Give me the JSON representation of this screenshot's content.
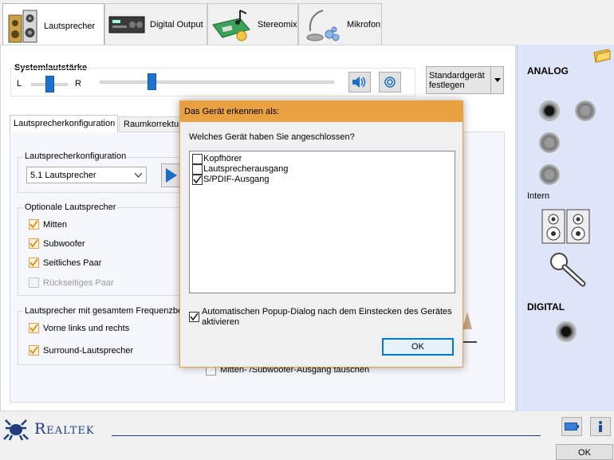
{
  "tabs": [
    {
      "label": "Lautsprecher",
      "icon": "speaker-icon"
    },
    {
      "label": "Digital Output",
      "icon": "digital-output-icon"
    },
    {
      "label": "Stereomix",
      "icon": "stereomix-icon"
    },
    {
      "label": "Mikrofon",
      "icon": "microphone-icon"
    }
  ],
  "volume": {
    "title": "Systemlautstärke",
    "left_label": "L",
    "right_label": "R",
    "balance_level": 0.5,
    "volume_level": 0.22
  },
  "default_device_button": "Standardgerät\nfestlegen",
  "subtabs": [
    "Lautsprecherkonfiguration",
    "Raumkorrektur"
  ],
  "speaker_config": {
    "group_label": "Lautsprecherkonfiguration",
    "selected": "5.1 Lautsprecher"
  },
  "optional_speakers": {
    "group_label": "Optionale Lautsprecher",
    "items": [
      {
        "label": "Mitten",
        "checked": true,
        "enabled": true
      },
      {
        "label": "Subwoofer",
        "checked": true,
        "enabled": true
      },
      {
        "label": "Seitliches Paar",
        "checked": true,
        "enabled": true
      },
      {
        "label": "Rückseitiges Paar",
        "checked": false,
        "enabled": false
      }
    ]
  },
  "fullrange": {
    "group_label": "Lautsprecher mit gesamtem Frequenzber",
    "items": [
      {
        "label": "Vorne links und rechts",
        "checked": true
      },
      {
        "label": "Surround-Lautsprecher",
        "checked": true
      }
    ]
  },
  "swap_checkbox": {
    "label": "Mitten- /Subwoofer-Ausgang tauschen",
    "checked": false
  },
  "dialog": {
    "title": "Das Gerät erkennen als:",
    "question": "Welches Gerät haben Sie angeschlossen?",
    "options": [
      {
        "label": "Kopfhörer",
        "checked": false
      },
      {
        "label": "Lautsprecherausgang",
        "checked": false
      },
      {
        "label": "S/PDIF-Ausgang",
        "checked": true
      }
    ],
    "auto_popup_label": "Automatischen Popup-Dialog nach dem Einstecken des Gerätes aktivieren",
    "auto_popup_checked": true,
    "ok_label": "OK"
  },
  "right_panel": {
    "analog_label": "ANALOG",
    "intern_label": "Intern",
    "digital_label": "DIGITAL"
  },
  "footer": {
    "brand": "Realtek",
    "ok_label": "OK"
  },
  "colors": {
    "accent_orange": "#e8a040",
    "right_panel_bg": "#dfe5f8",
    "realtek_blue": "#1f3d7a"
  }
}
